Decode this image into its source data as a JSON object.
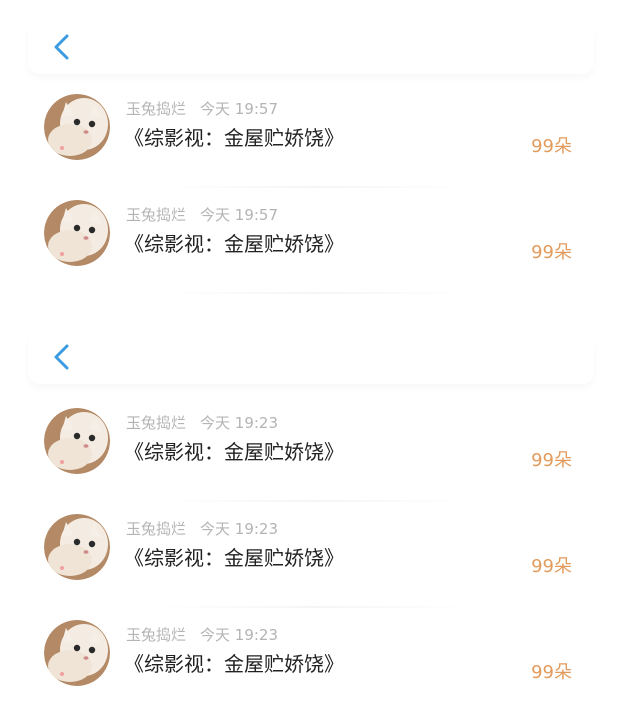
{
  "sections": [
    {
      "rows": [
        {
          "name": "玉兔捣烂",
          "time": "今天 19:57",
          "title": "《综影视：金屋贮娇饶》",
          "count": "99朵"
        },
        {
          "name": "玉兔捣烂",
          "time": "今天 19:57",
          "title": "《综影视：金屋贮娇饶》",
          "count": "99朵"
        }
      ]
    },
    {
      "rows": [
        {
          "name": "玉兔捣烂",
          "time": "今天 19:23",
          "title": "《综影视：金屋贮娇饶》",
          "count": "99朵"
        },
        {
          "name": "玉兔捣烂",
          "time": "今天 19:23",
          "title": "《综影视：金屋贮娇饶》",
          "count": "99朵"
        },
        {
          "name": "玉兔捣烂",
          "time": "今天 19:23",
          "title": "《综影视：金屋贮娇饶》",
          "count": "99朵"
        }
      ]
    }
  ],
  "icons": {
    "back": "chevron-left-icon",
    "avatar": "cat-avatar-icon"
  },
  "colors": {
    "accent_back": "#3a9be0",
    "count": "#e39b5c",
    "meta": "#b4b4b4",
    "title": "#222222"
  }
}
